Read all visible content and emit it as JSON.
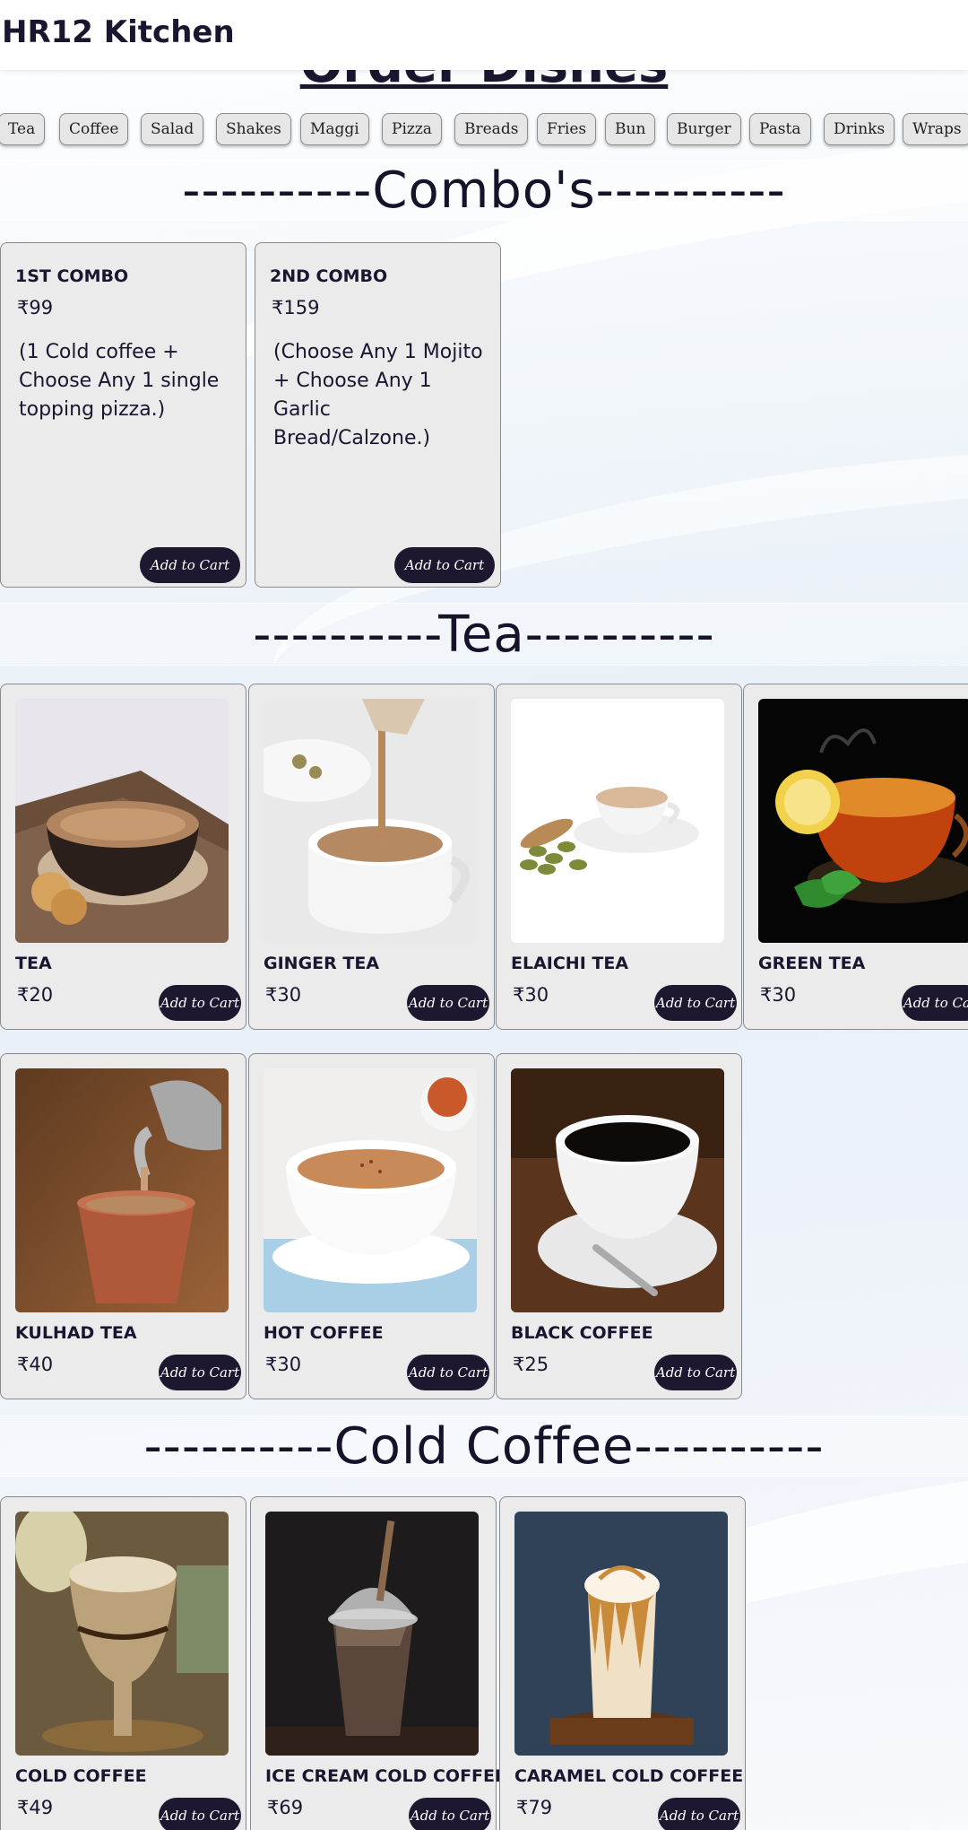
{
  "brand": "HR12 Kitchen",
  "peek_title": "Order Dishes",
  "categories": [
    "Tea",
    "Coffee",
    "Salad",
    "Shakes",
    "Maggi",
    "Pizza",
    "Breads",
    "Fries",
    "Bun",
    "Burger",
    "Pasta",
    "Drinks",
    "Wraps"
  ],
  "add_to_cart_label": "Add to Cart",
  "sections": {
    "combos_title": "----------Combo's----------",
    "tea_title": "----------Tea----------",
    "cold_coffee_title": "----------Cold Coffee----------"
  },
  "combos": [
    {
      "name": "1ST COMBO",
      "price": "₹99",
      "desc": "(1 Cold coffee + Choose Any 1 single topping pizza.)"
    },
    {
      "name": "2ND COMBO",
      "price": "₹159",
      "desc": "(Choose Any 1 Mojito + Choose Any 1 Garlic Bread/Calzone.)"
    }
  ],
  "tea_items": [
    {
      "name": "TEA",
      "price": "₹20"
    },
    {
      "name": "GINGER TEA",
      "price": "₹30"
    },
    {
      "name": "ELAICHI TEA",
      "price": "₹30"
    },
    {
      "name": "GREEN TEA",
      "price": "₹30"
    },
    {
      "name": "KULHAD TEA",
      "price": "₹40"
    },
    {
      "name": "HOT COFFEE",
      "price": "₹30"
    },
    {
      "name": "BLACK COFFEE",
      "price": "₹25"
    }
  ],
  "cold_coffee_items": [
    {
      "name": "COLD COFFEE",
      "price": "₹49"
    },
    {
      "name": "ICE CREAM COLD COFFEE",
      "price": "₹69"
    },
    {
      "name": "CARAMEL COLD COFFEE",
      "price": "₹79"
    }
  ],
  "colors": {
    "accent": "#1d1830",
    "card_bg": "#ebebeb"
  }
}
